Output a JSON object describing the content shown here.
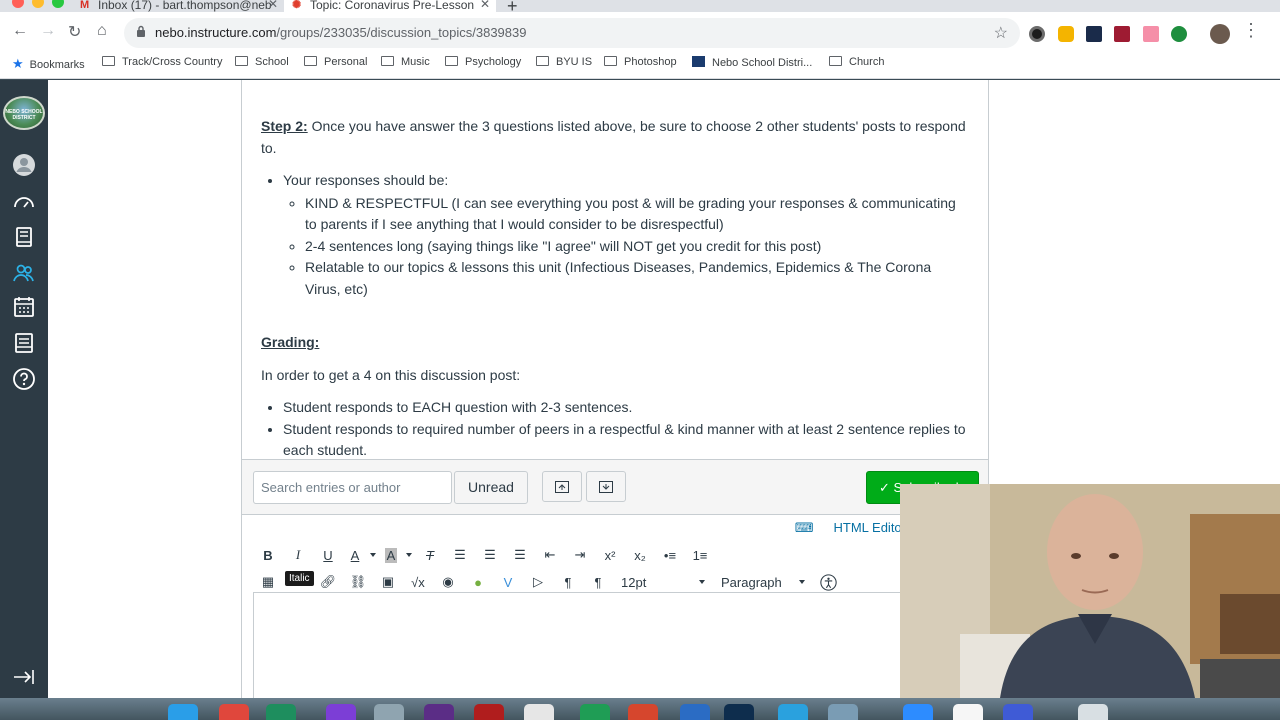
{
  "browser": {
    "tabs": [
      {
        "title": "Inbox (17) - bart.thompson@neb",
        "icon": "gmail-icon"
      },
      {
        "title": "Topic: Coronavirus Pre-Lesson",
        "icon": "canvas-icon"
      }
    ],
    "url_host": "nebo.instructure.com",
    "url_path": "/groups/233035/discussion_topics/3839839",
    "bookmarks": [
      {
        "label": "Bookmarks"
      },
      {
        "label": "Track/Cross Country"
      },
      {
        "label": "School"
      },
      {
        "label": "Personal"
      },
      {
        "label": "Music"
      },
      {
        "label": "Psychology"
      },
      {
        "label": "BYU IS"
      },
      {
        "label": "Photoshop"
      },
      {
        "label": "Nebo School Distri..."
      },
      {
        "label": "Church"
      }
    ]
  },
  "global_nav": {
    "logo_text": "NEBO SCHOOL DISTRICT",
    "items": [
      "account-icon",
      "dashboard-icon",
      "courses-icon",
      "groups-icon",
      "calendar-icon",
      "inbox-icon",
      "help-icon"
    ]
  },
  "post": {
    "step2_label": "Step 2:",
    "step2_text": " Once you have answer the 3 questions listed above, be sure to choose 2 other students' posts to respond to.",
    "responses_intro": "Your responses should be:",
    "responses": [
      "KIND & RESPECTFUL (I can see everything you post & will be grading your responses & communicating to parents if I see anything that I would consider to be disrespectful)",
      "2-4 sentences long (saying things like \"I agree\" will NOT get you credit for this post)",
      "Relatable to our topics & lessons this unit (Infectious Diseases, Pandemics, Epidemics & The Corona Virus, etc)"
    ],
    "grading_label": "Grading:",
    "grading_intro": "In order to get a 4 on this discussion post:",
    "grading_items": [
      "Student responds to EACH question with 2-3 sentences.",
      "Student responds to required number of peers in a respectful & kind manner with at least 2 sentence replies to each student."
    ]
  },
  "actions": {
    "search_placeholder": "Search entries or author",
    "unread_label": "Unread",
    "subscribed_label": "Subscribed"
  },
  "editor": {
    "html_link": "HTML Editor",
    "font_size": "12pt",
    "block_format": "Paragraph",
    "tooltip": "Italic"
  },
  "colors": {
    "nav_bg": "#2d3b45",
    "subscribed_green": "#00ac18",
    "link_blue": "#0770a3"
  }
}
